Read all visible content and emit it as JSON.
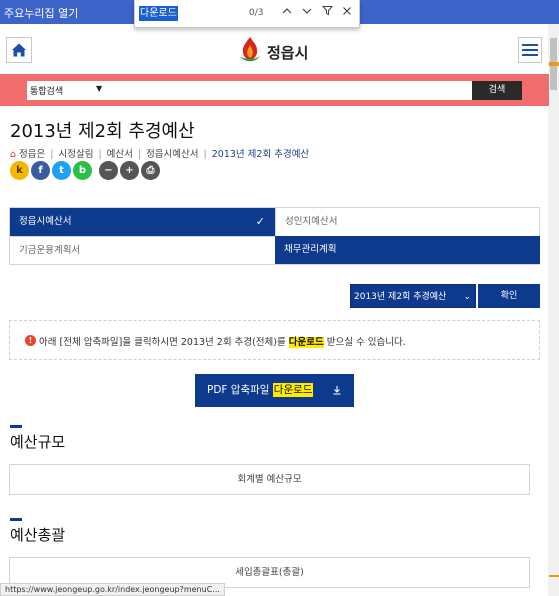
{
  "browser": {
    "quicklinks_label": "주요누리집 열기",
    "find": {
      "query": "다운로드",
      "count": "0/3"
    },
    "status_url": "https://www.jeongeup.go.kr/index.jeongeup?menuC..."
  },
  "header": {
    "logo_text": "정읍시"
  },
  "search": {
    "select_value": "통합검색",
    "button_label": "검색"
  },
  "page": {
    "title": "2013년 제2회 추경예산",
    "breadcrumb": [
      "정읍은",
      "시정살림",
      "예산서",
      "정읍시예산서",
      "2013년 제2회 추경예산"
    ]
  },
  "share": [
    {
      "icon": "kakaostory-icon",
      "glyph": "k",
      "color": "#f5b800"
    },
    {
      "icon": "facebook-icon",
      "glyph": "f",
      "color": "#3a5ba0"
    },
    {
      "icon": "twitter-icon",
      "glyph": "t",
      "color": "#1da1f2"
    },
    {
      "icon": "band-icon",
      "glyph": "b",
      "color": "#2dbe49"
    },
    {
      "icon": "zoom-out-icon",
      "glyph": "−",
      "color": "#555555"
    },
    {
      "icon": "zoom-in-icon",
      "glyph": "+",
      "color": "#555555"
    },
    {
      "icon": "print-icon",
      "glyph": "⎙",
      "color": "#555555"
    }
  ],
  "tabs": [
    {
      "label": "정읍시예산서",
      "active": true
    },
    {
      "label": "성인지예산서",
      "active": false
    },
    {
      "label": "기금운용계획서",
      "active": false
    },
    {
      "label": "채무관리계획",
      "active": true
    }
  ],
  "budget_select": {
    "value": "2013년 제2회 추경예산",
    "confirm_label": "확인"
  },
  "notice": {
    "before": "아래 [전체 압축파일]을 클릭하시면 2013년 2회 추경(전체)를 ",
    "highlight": "다운로드",
    "after": " 받으실 수 있습니다."
  },
  "pdf_button": {
    "prefix": "PDF 압축파일 ",
    "highlight": "다운로드"
  },
  "sections": [
    {
      "title": "예산규모",
      "box_label": "회계별 예산규모"
    },
    {
      "title": "예산총괄",
      "box_label": "세입총괄표(총괄)"
    }
  ],
  "colors": {
    "primary": "#0d3a8c",
    "search_band": "#f16c6c",
    "find_highlight": "#1a5fd1",
    "text_highlight": "#ffea00"
  }
}
